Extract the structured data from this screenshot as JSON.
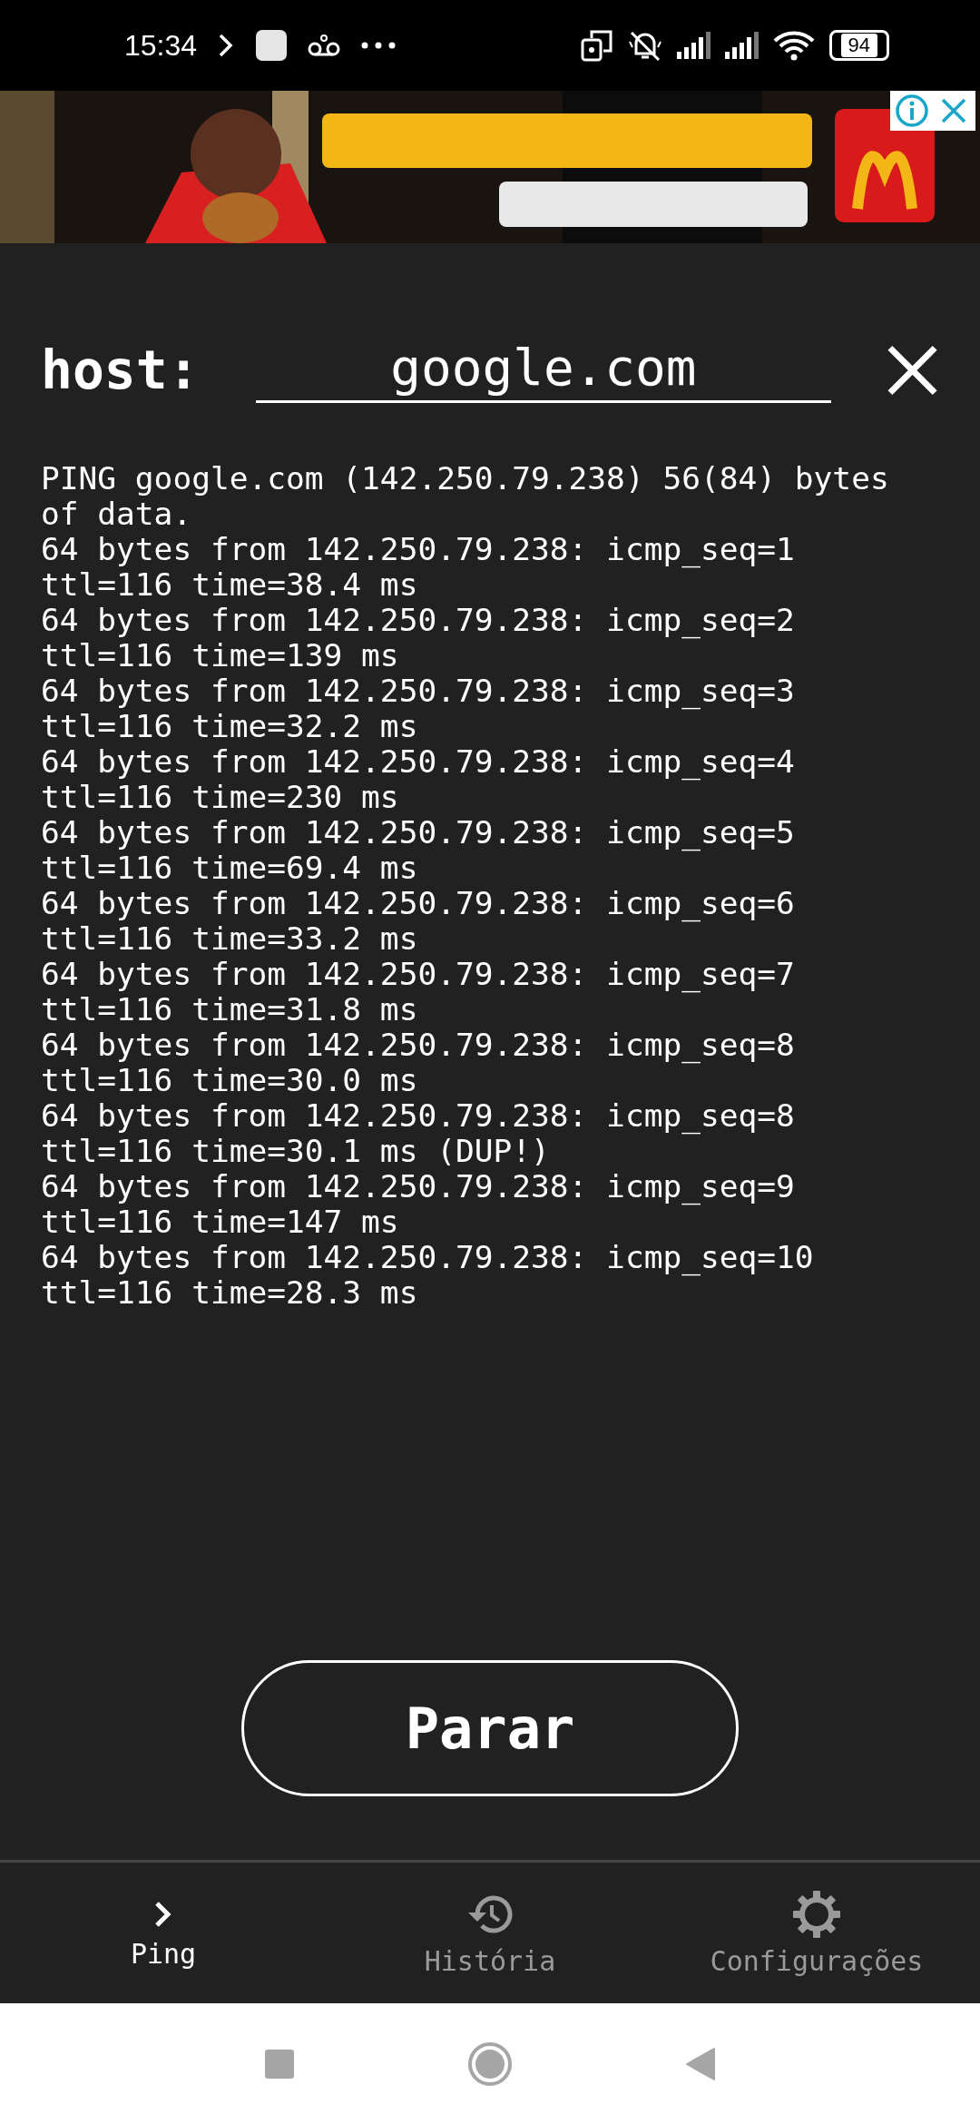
{
  "status_bar": {
    "time": "15:34",
    "battery": "94"
  },
  "host": {
    "label": "host:",
    "value": "google.com"
  },
  "output": [
    "PING google.com (142.250.79.238) 56(84) bytes of data.",
    "64 bytes from 142.250.79.238: icmp_seq=1 ttl=116 time=38.4 ms",
    "64 bytes from 142.250.79.238: icmp_seq=2 ttl=116 time=139 ms",
    "64 bytes from 142.250.79.238: icmp_seq=3 ttl=116 time=32.2 ms",
    "64 bytes from 142.250.79.238: icmp_seq=4 ttl=116 time=230 ms",
    "64 bytes from 142.250.79.238: icmp_seq=5 ttl=116 time=69.4 ms",
    "64 bytes from 142.250.79.238: icmp_seq=6 ttl=116 time=33.2 ms",
    "64 bytes from 142.250.79.238: icmp_seq=7 ttl=116 time=31.8 ms",
    "64 bytes from 142.250.79.238: icmp_seq=8 ttl=116 time=30.0 ms",
    "64 bytes from 142.250.79.238: icmp_seq=8 ttl=116 time=30.1 ms (DUP!)",
    "64 bytes from 142.250.79.238: icmp_seq=9 ttl=116 time=147 ms",
    "64 bytes from 142.250.79.238: icmp_seq=10 ttl=116 time=28.3 ms"
  ],
  "action_button": "Parar",
  "nav": [
    {
      "kind": "ping",
      "label": "Ping",
      "selected": true
    },
    {
      "kind": "history",
      "label": "História",
      "selected": false
    },
    {
      "kind": "settings",
      "label": "Configurações",
      "selected": false
    }
  ]
}
